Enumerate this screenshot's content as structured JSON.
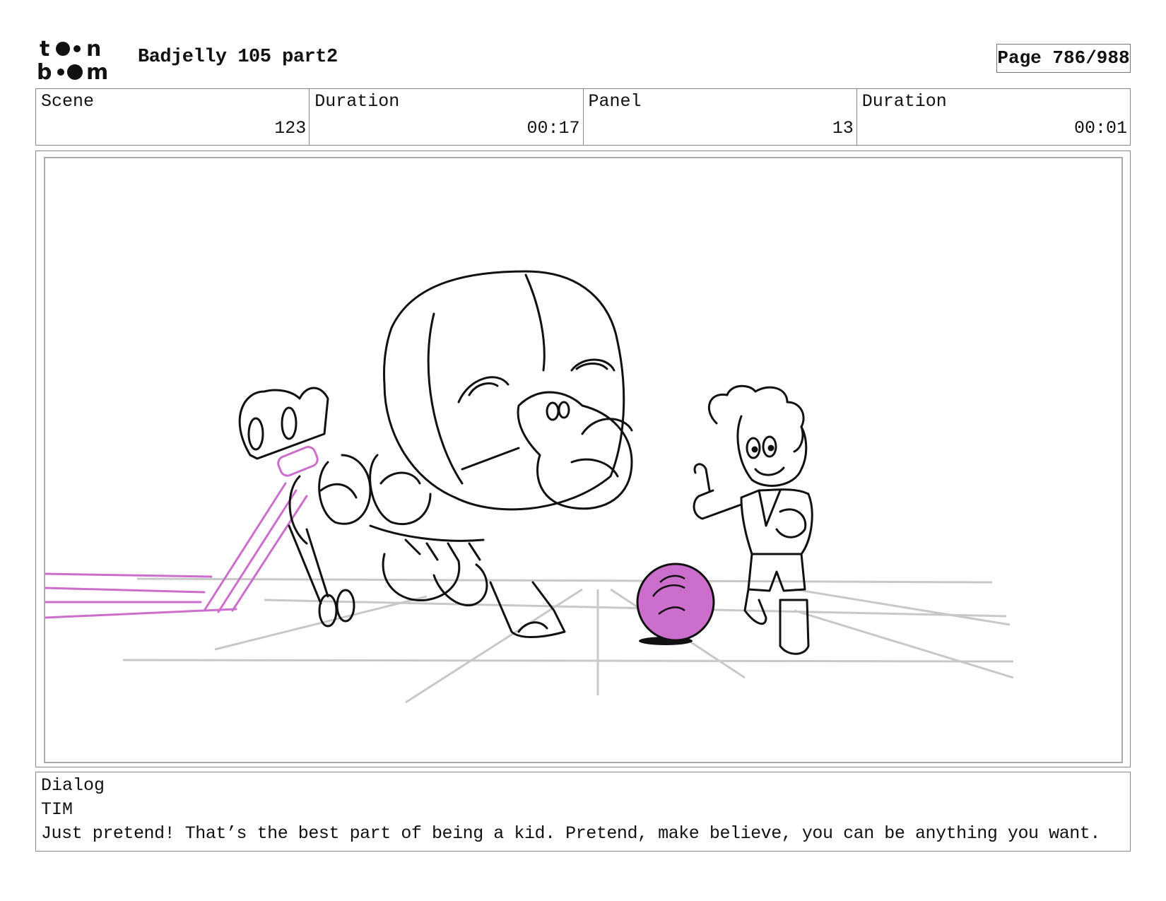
{
  "header": {
    "logo_text_top": "toon",
    "logo_text_bottom": "boom",
    "project_title": "Badjelly 105 part2",
    "page_label": "Page 786/988"
  },
  "info": {
    "scene_label": "Scene",
    "scene_value": "123",
    "scene_duration_label": "Duration",
    "scene_duration_value": "00:17",
    "panel_label": "Panel",
    "panel_value": "13",
    "panel_duration_label": "Duration",
    "panel_duration_value": "00:01"
  },
  "dialog": {
    "label": "Dialog",
    "speaker": "TIM",
    "text": "Just pretend! That’s the best part of being a kid. Pretend, make believe, you can be anything you want."
  },
  "colors": {
    "sketch_line": "#111111",
    "floor_grid": "#c8c8c8",
    "accent_magenta": "#cc6fcc"
  }
}
